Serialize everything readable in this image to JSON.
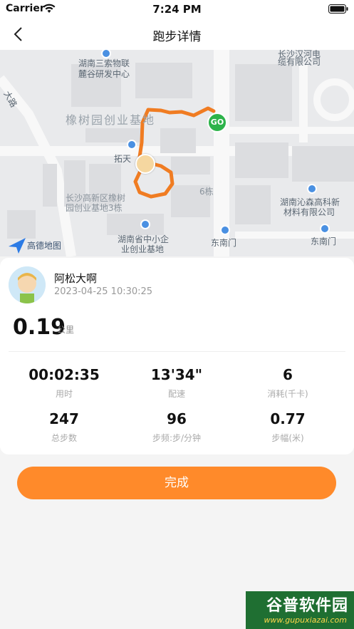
{
  "status_bar": {
    "carrier": "Carrier",
    "time": "7:24 PM"
  },
  "nav": {
    "title": "跑步详情"
  },
  "map": {
    "labels": {
      "sanso": "湖南三索物联",
      "lugu": "麓谷研发中心",
      "changsha_river": "长沙汉河电",
      "cable": "缆有限公司",
      "park": "橡树园创业基地",
      "tuotian": "拓天",
      "hightech_1": "长沙高新区橡树",
      "hightech_2": "园创业基地3栋",
      "building6": "6栋",
      "qinsen_1": "湖南沁森高科新",
      "qinsen_2": "材料有限公司",
      "sme_1": "湖南省中小企",
      "sme_2": "业创业基地",
      "east_gate_1": "东南门",
      "east_gate_2": "东南门",
      "road": "大路",
      "logo": "高德地图"
    },
    "go_marker": "GO",
    "route_color": "#f07c22"
  },
  "user": {
    "name": "阿松大啊",
    "time": "2023-04-25 10:30:25"
  },
  "distance": {
    "value": "0.19",
    "unit": "公里"
  },
  "stats": [
    {
      "value": "00:02:35",
      "label": "用时"
    },
    {
      "value": "13'34\"",
      "label": "配速"
    },
    {
      "value": "6",
      "label": "消耗(千卡)"
    },
    {
      "value": "247",
      "label": "总步数"
    },
    {
      "value": "96",
      "label": "步频:步/分钟"
    },
    {
      "value": "0.77",
      "label": "步幅(米)"
    }
  ],
  "done_button": "完成",
  "watermark": {
    "title": "谷普软件园",
    "url": "www.gupuxiazai.com"
  },
  "colors": {
    "accent": "#ff8a2a",
    "go": "#2db34a"
  }
}
